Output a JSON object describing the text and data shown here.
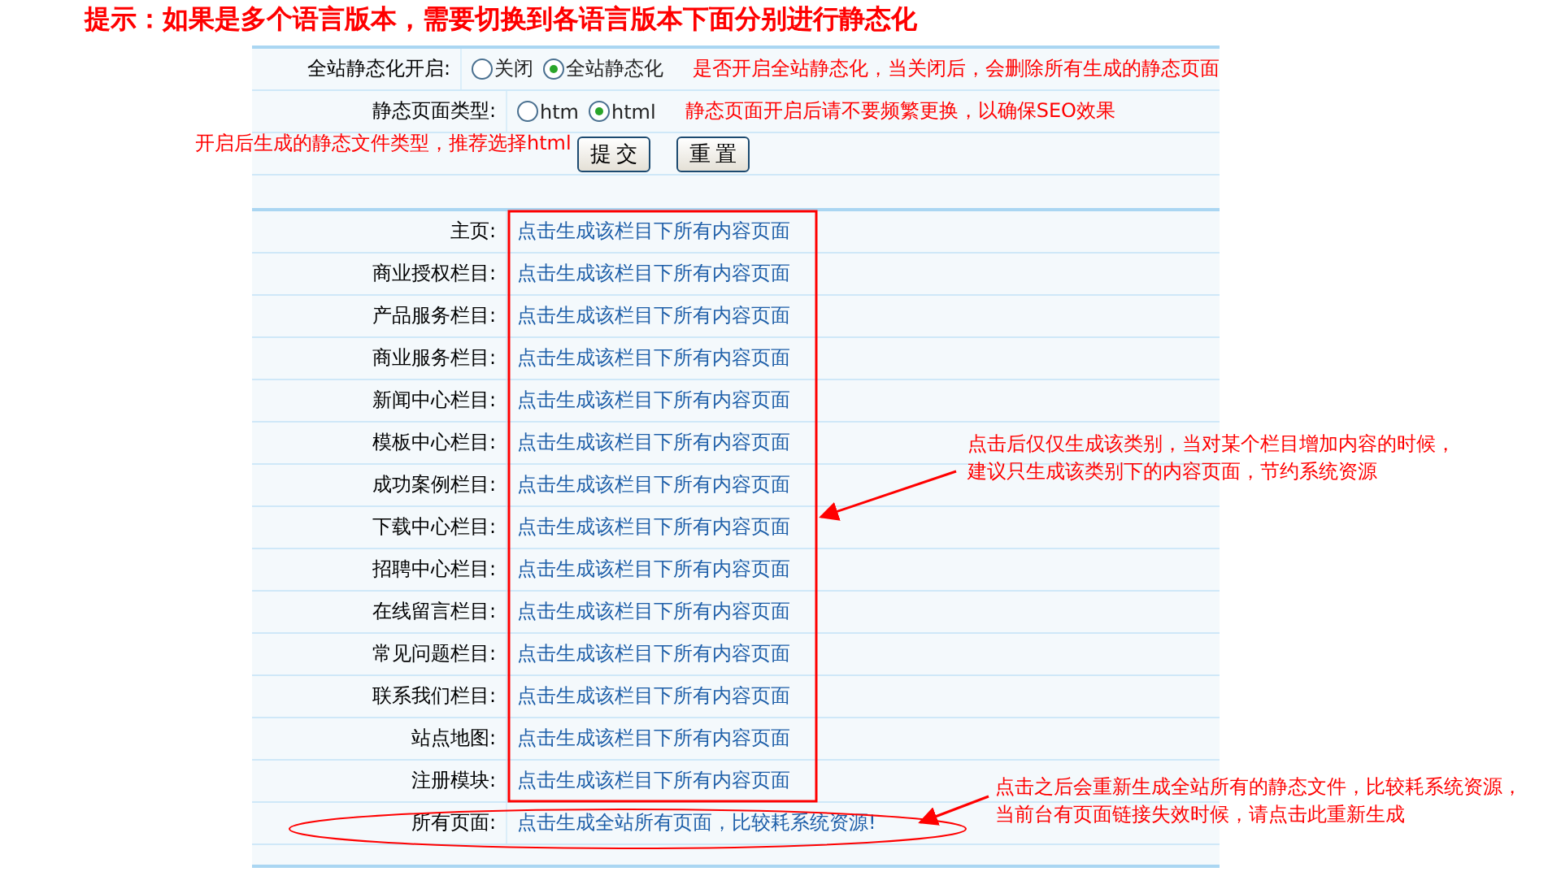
{
  "title": "提示：如果是多个语言版本，需要切换到各语言版本下面分别进行静态化",
  "settings": [
    {
      "label": "全站静态化开启:",
      "options": [
        {
          "label": "关闭",
          "selected": false
        },
        {
          "label": "全站静态化",
          "selected": true
        }
      ],
      "note": "是否开启全站静态化，当关闭后，会删除所有生成的静态页面"
    },
    {
      "label": "静态页面类型:",
      "options": [
        {
          "label": "htm",
          "selected": false
        },
        {
          "label": "html",
          "selected": true
        }
      ],
      "note": "静态页面开启后请不要频繁更换，以确保SEO效果"
    }
  ],
  "buttons": [
    "提交",
    "重置"
  ],
  "rows": [
    {
      "label": "主页:",
      "link": "点击生成该栏目下所有内容页面"
    },
    {
      "label": "商业授权栏目:",
      "link": "点击生成该栏目下所有内容页面"
    },
    {
      "label": "产品服务栏目:",
      "link": "点击生成该栏目下所有内容页面"
    },
    {
      "label": "商业服务栏目:",
      "link": "点击生成该栏目下所有内容页面"
    },
    {
      "label": "新闻中心栏目:",
      "link": "点击生成该栏目下所有内容页面"
    },
    {
      "label": "模板中心栏目:",
      "link": "点击生成该栏目下所有内容页面"
    },
    {
      "label": "成功案例栏目:",
      "link": "点击生成该栏目下所有内容页面"
    },
    {
      "label": "下载中心栏目:",
      "link": "点击生成该栏目下所有内容页面"
    },
    {
      "label": "招聘中心栏目:",
      "link": "点击生成该栏目下所有内容页面"
    },
    {
      "label": "在线留言栏目:",
      "link": "点击生成该栏目下所有内容页面"
    },
    {
      "label": "常见问题栏目:",
      "link": "点击生成该栏目下所有内容页面"
    },
    {
      "label": "联系我们栏目:",
      "link": "点击生成该栏目下所有内容页面"
    },
    {
      "label": "站点地图:",
      "link": "点击生成该栏目下所有内容页面"
    },
    {
      "label": "注册模块:",
      "link": "点击生成该栏目下所有内容页面"
    }
  ],
  "all_pages": {
    "label": "所有页面:",
    "link": "点击生成全站所有页面，比较耗系统资源!"
  },
  "annotations": {
    "file_type": "开启后生成的静态文件类型，推荐选择html",
    "category": [
      "点击后仅仅生成该类别，当对某个栏目增加内容的时候，",
      "建议只生成该类别下的内容页面，节约系统资源"
    ],
    "all_pages": [
      "点击之后会重新生成全站所有的静态文件，比较耗系统资源，",
      "当前台有页面链接失效时候，请点击此重新生成"
    ]
  }
}
